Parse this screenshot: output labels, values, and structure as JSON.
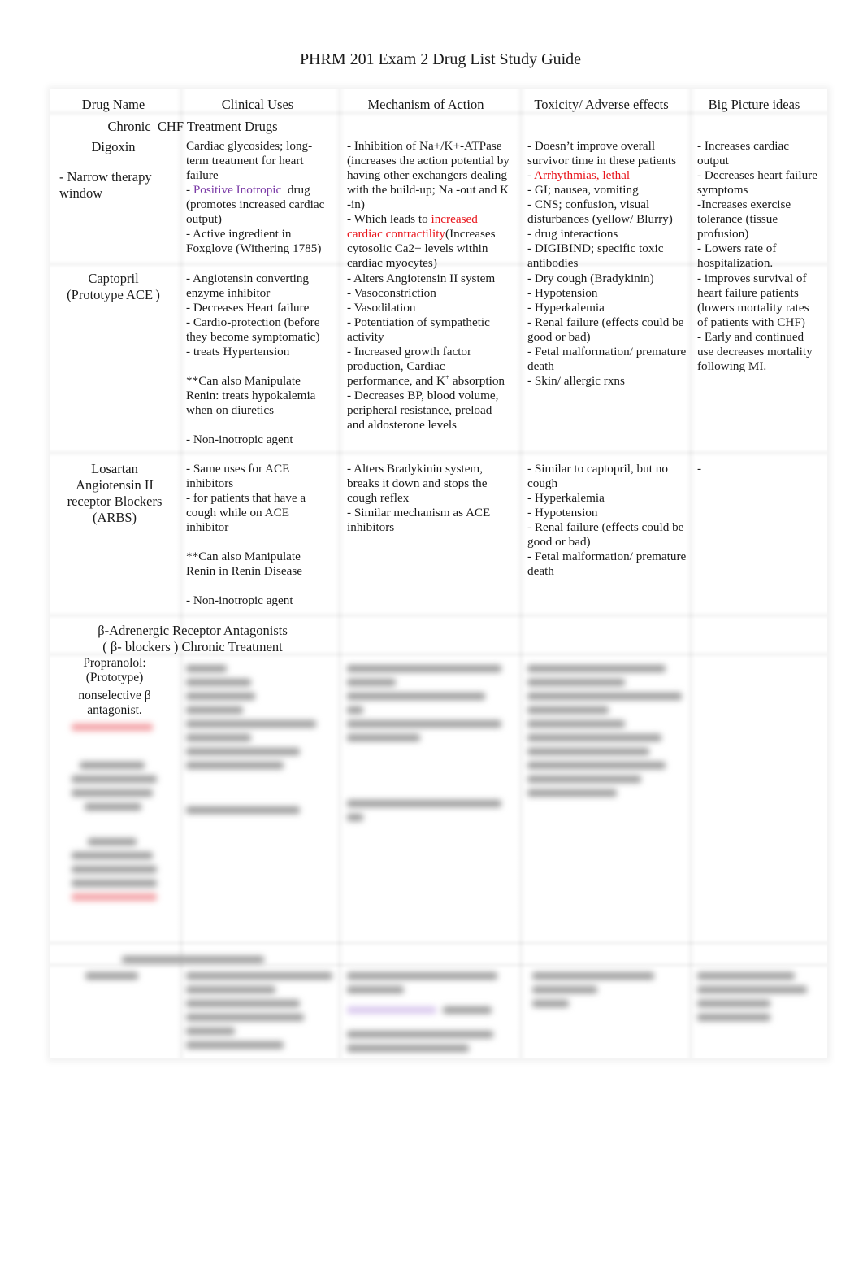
{
  "document": {
    "title": "PHRM 201 Exam 2 Drug List Study Guide",
    "colors": {
      "highlight_red": "#e8141b",
      "highlight_purple": "#7a3aa6"
    }
  },
  "table": {
    "headers": [
      "Drug Name",
      "Clinical Uses",
      "Mechanism of Action",
      "Toxicity/ Adverse effects",
      "Big Picture ideas"
    ],
    "sections": [
      {
        "title": "Chronic  CHF Treatment Drugs",
        "rows": [
          {
            "drug": {
              "name": "Digoxin",
              "note": "- Narrow therapy window"
            },
            "clinical_uses": {
              "intro": "Cardiac glycosides; long-term treatment for heart failure",
              "positive_prefix": "- ",
              "positive_highlight": "Positive Inotropic",
              "positive_rest": "  drug (promotes increased cardiac output)",
              "active": "- Active ingredient in Foxglove (Withering 1785)"
            },
            "mechanism": {
              "inhibition": "-  Inhibition of Na+/K+-ATPase (increases the action potential by having other exchangers dealing with the build-up; Na -out and K -in)",
              "leads_prefix": "- Which leads to ",
              "leads_highlight": "increased cardiac contractility",
              "leads_rest": "(Increases cytosolic Ca2+ levels within cardiac myocytes)"
            },
            "toxicity": {
              "survivor": "- Doesn’t improve overall survivor time in these patients",
              "arr_prefix": "- ",
              "arr_highlight": "Arrhythmias, lethal",
              "gi": "- GI; nausea, vomiting",
              "cns": "- CNS; confusion, visual disturbances (yellow/ Blurry)",
              "interactions": "- drug interactions",
              "digibind": "- DIGIBIND; specific toxic antibodies"
            },
            "big_picture": [
              "- Increases cardiac output",
              "- Decreases heart failure symptoms",
              "-Increases exercise tolerance (tissue profusion)",
              "- Lowers rate of hospitalization."
            ]
          },
          {
            "drug": {
              "name": "Captopril",
              "note": "(Prototype ACE )"
            },
            "clinical_uses": [
              "- Angiotensin converting enzyme inhibitor",
              "- Decreases Heart failure",
              "- Cardio-protection (before they become symptomatic)",
              "- treats Hypertension",
              "**Can also Manipulate Renin: treats hypokalemia when on diuretics",
              "- Non-inotropic agent"
            ],
            "mechanism": {
              "items": [
                "- Alters Angiotensin II system",
                "- Vasoconstriction",
                "- Vasodilation",
                "- Potentiation of sympathetic activity"
              ],
              "growth_prefix": "- Increased growth factor production, Cardiac performance, and K",
              "growth_sup": "+",
              "growth_rest": " absorption",
              "decreases": "- Decreases BP, blood volume, peripheral resistance, preload and aldosterone levels"
            },
            "toxicity": [
              "- Dry cough (Bradykinin)",
              "- Hypotension",
              "- Hyperkalemia",
              "- Renal failure (effects could be good or bad)",
              "- Fetal malformation/ premature death",
              "- Skin/ allergic rxns"
            ],
            "big_picture": [
              "- improves survival of heart failure patients (lowers mortality rates of patients with CHF)",
              "- Early and continued use decreases mortality following MI."
            ]
          },
          {
            "drug": {
              "name": "Losartan Angiotensin II receptor Blockers (ARBS)"
            },
            "clinical_uses": [
              "- Same uses for ACE inhibitors",
              "- for patients that have a cough while on ACE inhibitor",
              "**Can also Manipulate Renin in Renin Disease",
              "- Non-inotropic agent"
            ],
            "mechanism": [
              "- Alters Bradykinin system, breaks it down and stops the cough reflex",
              "- Similar mechanism as ACE inhibitors"
            ],
            "toxicity": [
              "- Similar to captopril, but no cough",
              "- Hyperkalemia",
              "- Hypotension",
              "- Renal failure (effects could be good or bad)",
              "- Fetal malformation/ premature death"
            ],
            "big_picture": [
              "-"
            ]
          }
        ]
      },
      {
        "title": "β-Adrenergic Receptor Antagonists ( β- blockers ) Chronic Treatment",
        "title_lines": [
          "β-Adrenergic Receptor Antagonists",
          "( β- blockers ) Chronic Treatment"
        ],
        "rows": [
          {
            "drug": {
              "lines": [
                "Propranolol:",
                "(Prototype)",
                "nonselective β",
                "antagonist."
              ]
            },
            "blurred": true
          }
        ]
      }
    ]
  }
}
